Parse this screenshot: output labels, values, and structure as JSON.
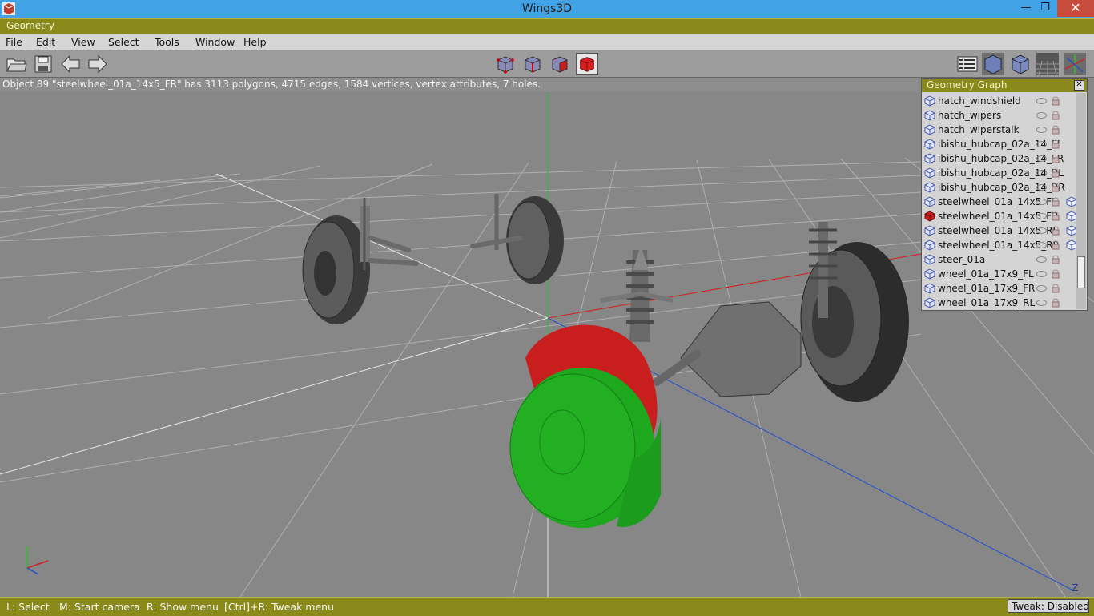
{
  "window": {
    "title": "Wings3D"
  },
  "geometry_header": {
    "label": "Geometry"
  },
  "menu": {
    "items": [
      "File",
      "Edit",
      "View",
      "Select",
      "Tools",
      "Window",
      "Help"
    ]
  },
  "toolbar": {
    "left_icons": [
      "open-folder-icon",
      "save-icon",
      "undo-arrow-icon",
      "redo-arrow-icon"
    ],
    "selection_modes": [
      "vertex-select-icon",
      "edge-select-icon",
      "face-select-icon",
      "body-select-icon"
    ],
    "active_mode": "body-select-icon",
    "right_icons": [
      "outliner-icon",
      "smooth-shade-icon",
      "flat-shade-icon",
      "ground-plane-icon",
      "axes-icon"
    ]
  },
  "info": {
    "text": "Object 89 \"steelwheel_01a_14x5_FR\" has 3113 polygons, 4715 edges, 1584 vertices, vertex attributes, 7 holes."
  },
  "geometry_graph": {
    "title": "Geometry Graph",
    "objects": [
      {
        "name": "hatch_windshield",
        "selected": false,
        "extra": false
      },
      {
        "name": "hatch_wipers",
        "selected": false,
        "extra": false
      },
      {
        "name": "hatch_wiperstalk",
        "selected": false,
        "extra": false
      },
      {
        "name": "ibishu_hubcap_02a_14_FL",
        "selected": false,
        "extra": false
      },
      {
        "name": "ibishu_hubcap_02a_14_FR",
        "selected": false,
        "extra": false
      },
      {
        "name": "ibishu_hubcap_02a_14_RL",
        "selected": false,
        "extra": false
      },
      {
        "name": "ibishu_hubcap_02a_14_RR",
        "selected": false,
        "extra": false
      },
      {
        "name": "steelwheel_01a_14x5_FL",
        "selected": false,
        "extra": true
      },
      {
        "name": "steelwheel_01a_14x5_FR",
        "selected": true,
        "extra": true
      },
      {
        "name": "steelwheel_01a_14x5_RL",
        "selected": false,
        "extra": true
      },
      {
        "name": "steelwheel_01a_14x5_RR",
        "selected": false,
        "extra": true
      },
      {
        "name": "steer_01a",
        "selected": false,
        "extra": false
      },
      {
        "name": "wheel_01a_17x9_FL",
        "selected": false,
        "extra": false
      },
      {
        "name": "wheel_01a_17x9_FR",
        "selected": false,
        "extra": false
      },
      {
        "name": "wheel_01a_17x9_RL",
        "selected": false,
        "extra": false
      }
    ]
  },
  "axis_labels": {
    "z": "Z"
  },
  "status": {
    "select": "L: Select",
    "camera": "M: Start camera",
    "menu": "R: Show menu",
    "tweak_menu": "[Ctrl]+R: Tweak menu",
    "tweak_state": "Tweak: Disabled"
  },
  "colors": {
    "title_bar": "#41a2e6",
    "panel_header": "#8a8a1a",
    "viewport": "#878787",
    "x_axis": "#d21e1e",
    "y_axis": "#1ec81e",
    "z_axis": "#1e50d2",
    "selected_red": "#c81e1e",
    "selected_green": "#1eaa1e"
  }
}
